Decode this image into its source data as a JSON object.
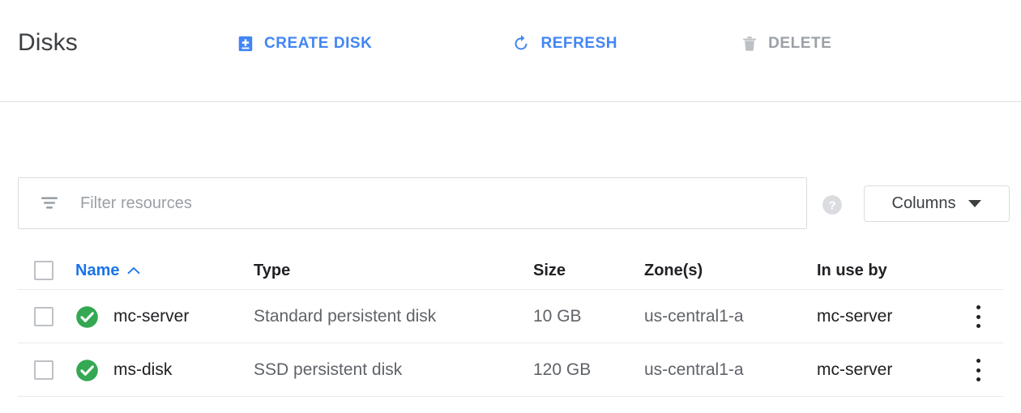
{
  "header": {
    "title": "Disks",
    "toolbar": [
      {
        "label": "CREATE DISK",
        "icon": "add-disk-icon",
        "disabled": false
      },
      {
        "label": "REFRESH",
        "icon": "refresh-icon",
        "disabled": false
      },
      {
        "label": "DELETE",
        "icon": "trash-icon",
        "disabled": true
      }
    ]
  },
  "filter": {
    "placeholder": "Filter resources",
    "value": "",
    "icon": "filter-icon",
    "help_icon": "help-circle-icon",
    "columns_label": "Columns"
  },
  "table": {
    "columns": [
      {
        "key": "name",
        "label": "Name",
        "sorted": true,
        "sort_dir": "asc"
      },
      {
        "key": "type",
        "label": "Type",
        "sorted": false
      },
      {
        "key": "size",
        "label": "Size",
        "sorted": false
      },
      {
        "key": "zone",
        "label": "Zone(s)",
        "sorted": false
      },
      {
        "key": "inuse",
        "label": "In use by",
        "sorted": false
      }
    ],
    "rows": [
      {
        "status": "ok",
        "name": "mc-server",
        "type": "Standard persistent disk",
        "size": "10 GB",
        "zone": "us-central1-a",
        "inuse": "mc-server",
        "selected": false
      },
      {
        "status": "ok",
        "name": "ms-disk",
        "type": "SSD persistent disk",
        "size": "120 GB",
        "zone": "us-central1-a",
        "inuse": "mc-server",
        "selected": false
      }
    ]
  },
  "colors": {
    "accent_blue": "#4285f4",
    "link_blue": "#1a73e8",
    "status_green": "#34a853",
    "disabled_grey": "#9aa0a6",
    "text_primary": "#202124",
    "text_secondary": "#5f6368",
    "border": "#dadce0"
  }
}
